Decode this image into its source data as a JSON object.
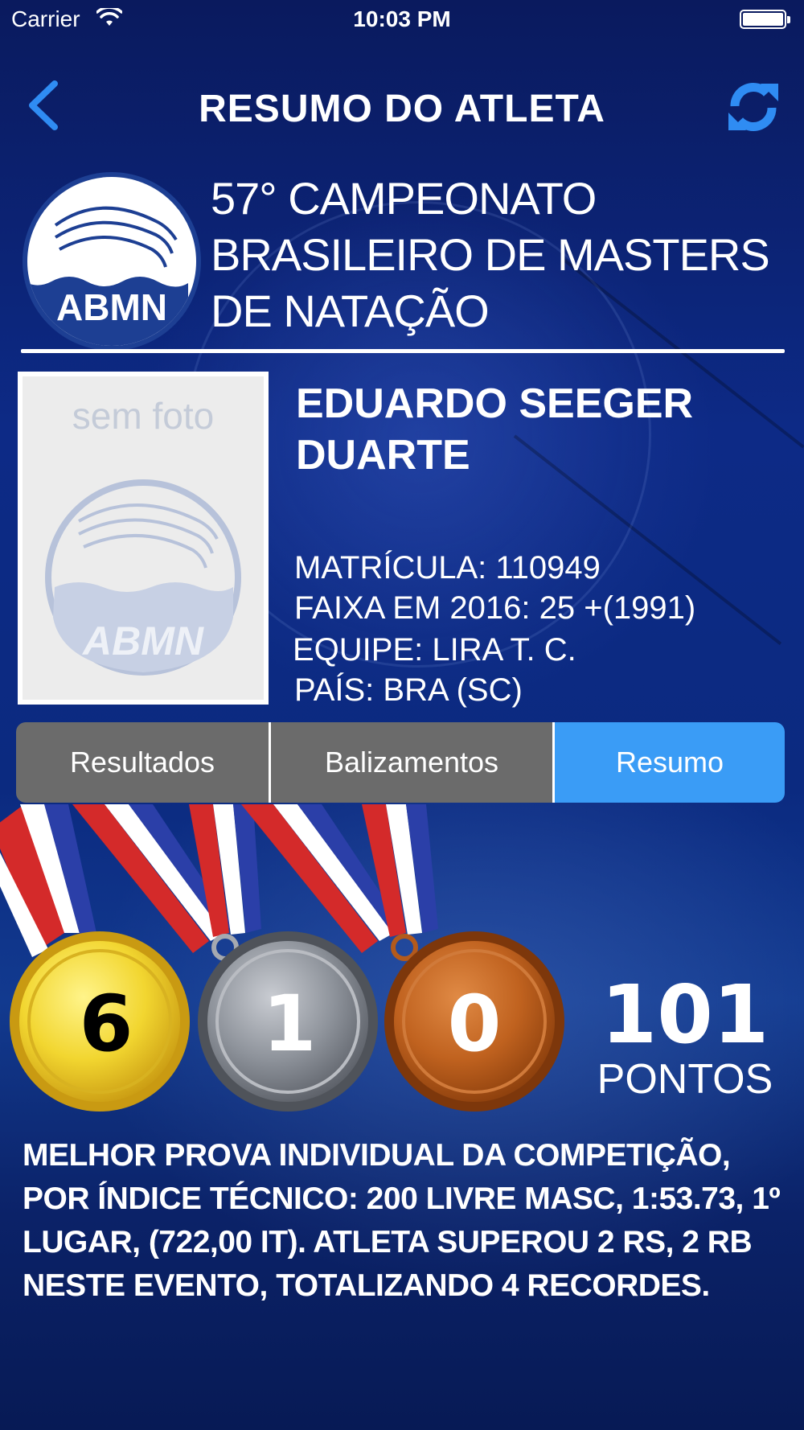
{
  "status_bar": {
    "carrier": "Carrier",
    "time": "10:03 PM"
  },
  "nav": {
    "title": "RESUMO DO ATLETA",
    "back_icon": "chevron-left-icon",
    "refresh_icon": "refresh-icon"
  },
  "event": {
    "title_lines": [
      "57° CAMPEONATO",
      "BRASILEIRO DE MASTERS",
      "DE NATAÇÃO"
    ],
    "logo_text": "ABMN"
  },
  "athlete": {
    "photo_placeholder": "sem foto",
    "photo_logo_text": "ABMN",
    "name_lines": [
      "EDUARDO SEEGER",
      "DUARTE"
    ],
    "matricula": "MATRÍCULA: 110949",
    "faixa": "FAIXA EM 2016: 25 +(1991)",
    "equipe": "EQUIPE: LIRA T. C.",
    "pais": "PAÍS: BRA (SC)"
  },
  "tabs": [
    {
      "label": "Resultados",
      "active": false
    },
    {
      "label": "Balizamentos",
      "active": false
    },
    {
      "label": "Resumo",
      "active": true
    }
  ],
  "medals": {
    "gold": "6",
    "silver": "1",
    "bronze": "0"
  },
  "points": {
    "value": "101",
    "label": "PONTOS"
  },
  "summary": "MELHOR PROVA INDIVIDUAL DA COMPETIÇÃO, POR ÍNDICE TÉCNICO: 200 LIVRE MASC, 1:53.73, 1º LUGAR, (722,00 IT). ATLETA SUPEROU 2 RS, 2 RB NESTE EVENTO, TOTALIZANDO 4 RECORDES.",
  "colors": {
    "accent": "#3a9cf6",
    "segment_inactive": "#6b6b6b",
    "gold": "#f2d630",
    "silver": "#8e939b",
    "bronze": "#c0621f"
  }
}
